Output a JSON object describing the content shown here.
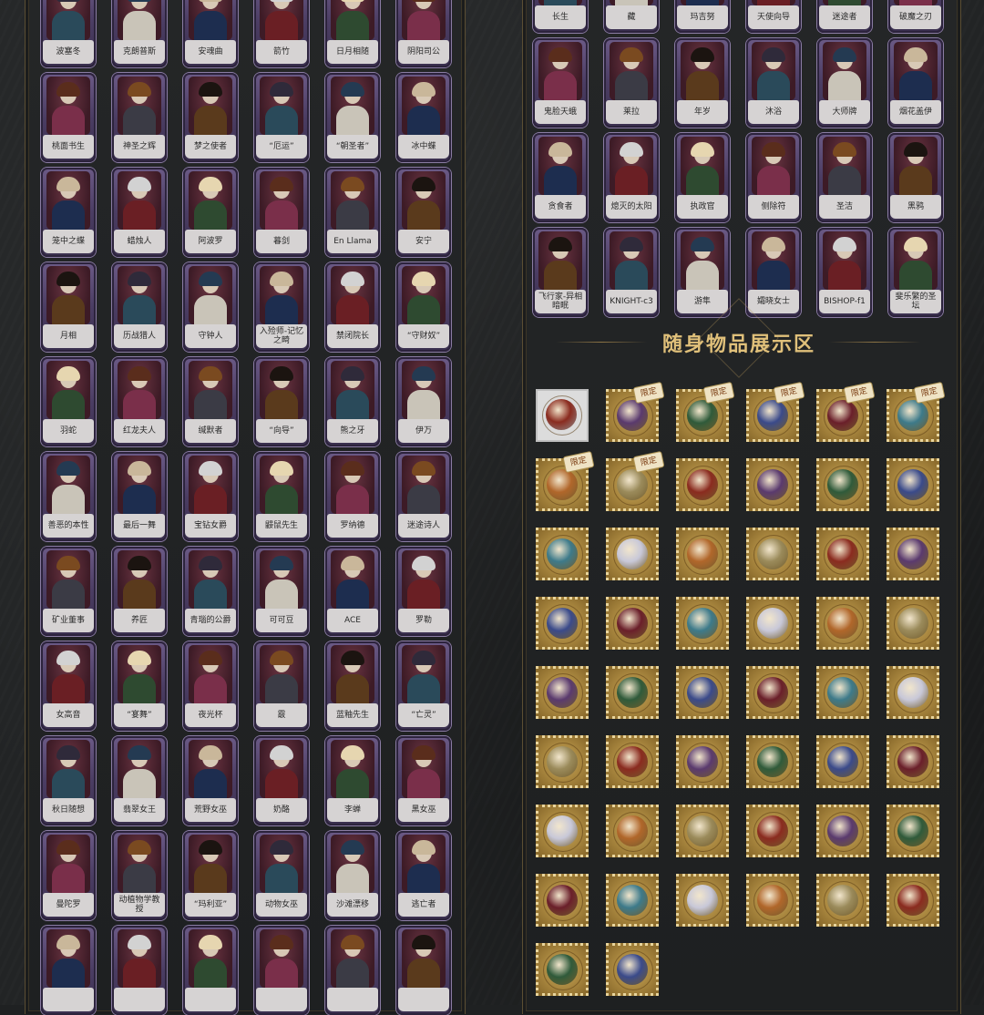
{
  "section_title": "随身物品展示区",
  "limited_tag": "限定",
  "left_rows": [
    [
      "波塞冬",
      "克朗普斯",
      "安魂曲",
      "箭竹",
      "日月相随",
      "阴阳司公"
    ],
    [
      "桃面书生",
      "神圣之辉",
      "梦之使者",
      "“厄运”",
      "“朝圣者”",
      "冰中蝶"
    ],
    [
      "笼中之蝶",
      "蜡烛人",
      "阿波罗",
      "暮剑",
      "En Llama",
      "安宁"
    ],
    [
      "月相",
      "历战猎人",
      "守钟人",
      "入殓师-记忆之畸",
      "禁闭院长",
      "“守财奴”"
    ],
    [
      "羽蛇",
      "红龙夫人",
      "缄默者",
      "“向导”",
      "熊之牙",
      "伊万"
    ],
    [
      "善恶的本性",
      "最后一舞",
      "宝钻女爵",
      "鼹鼠先生",
      "罗纳德",
      "迷途诗人"
    ],
    [
      "矿业董事",
      "养匠",
      "青瑙的公爵",
      "可可豆",
      "ACE",
      "罗勒"
    ],
    [
      "女高音",
      "“宴舞”",
      "夜光杯",
      "霰",
      "蓝釉先生",
      "“亡灵”"
    ],
    [
      "秋日随想",
      "翡翠女王",
      "荒野女巫",
      "奶酪",
      "李蝉",
      "黑女巫"
    ],
    [
      "曼陀罗",
      "动植物学教授",
      "“玛利亚”",
      "动物女巫",
      "沙滩漂移",
      "逃亡者"
    ],
    [
      "",
      "",
      "",
      "",
      "",
      ""
    ]
  ],
  "right_rows": [
    [
      "长生",
      "藏",
      "玛吉努",
      "天使向导",
      "迷途者",
      "破魔之刃"
    ],
    [
      "鬼脸天蛾",
      "莱拉",
      "年岁",
      "沐浴",
      "大师牌",
      "烟花盖伊"
    ],
    [
      "贪食者",
      "熄灭的太阳",
      "执政官",
      "侧除符",
      "圣洁",
      "黑鸦"
    ],
    [
      "飞行家-异相暗眠",
      "KNIGHT-c3",
      "游隼",
      "孀晓女士",
      "BISHOP-f1",
      "斐乐繁的圣坛"
    ]
  ],
  "item_rows": [
    [
      false,
      true,
      true,
      true,
      true,
      true
    ],
    [
      true,
      true,
      false,
      false,
      false,
      false
    ],
    [
      false,
      false,
      false,
      false,
      false,
      false
    ],
    [
      false,
      false,
      false,
      false,
      false,
      false
    ],
    [
      false,
      false,
      false,
      false,
      false,
      false
    ],
    [
      false,
      false,
      false,
      false,
      false,
      false
    ],
    [
      false,
      false,
      false,
      false,
      false,
      false
    ],
    [
      false,
      false,
      false,
      false,
      false,
      false
    ],
    [
      false,
      false
    ]
  ],
  "colors": {
    "card_frame": "#6b5a86",
    "card_label": "#d6d3d3",
    "stamp_gold": "#c9a95f",
    "title_gold": "#e0c07a"
  }
}
